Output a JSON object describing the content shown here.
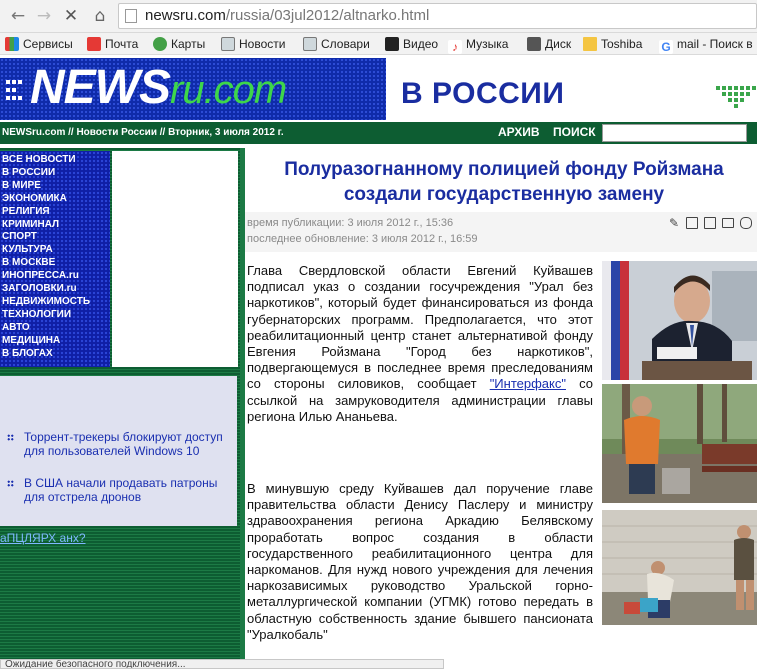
{
  "browser": {
    "url_domain": "newsru.com",
    "url_path": "/russia/03jul2012/altnarko.html",
    "bookmarks": [
      "Сервисы",
      "Почта",
      "Карты",
      "Новости",
      "Словари",
      "Видео",
      "Музыка",
      "Диск",
      "Toshiba",
      "mail - Поиск в"
    ]
  },
  "header": {
    "logo_main": "NEWS",
    "logo_ru": "ru.com",
    "section": "В РОССИИ",
    "breadcrumb": "NEWSru.com // Новости России // Вторник, 3 июля 2012 г.",
    "archive": "АРХИВ",
    "search": "ПОИСК"
  },
  "menu": [
    "ВСЕ НОВОСТИ",
    "В РОССИИ",
    "В МИРЕ",
    "ЭКОНОМИКА",
    "РЕЛИГИЯ",
    "КРИМИНАЛ",
    "СПОРТ",
    "КУЛЬТУРА",
    "В МОСКВЕ",
    "ИНОПРЕССА.ru",
    "ЗАГОЛОВКИ.ru",
    "НЕДВИЖИМОСТЬ",
    "ТЕХНОЛОГИИ",
    "АВТО",
    "МЕДИЦИНА",
    "В БЛОГАХ"
  ],
  "side_news": [
    "Торрент-трекеры блокируют доступ для пользователей Windows 10",
    "В США начали продавать патроны для отстрела дронов"
  ],
  "promo": "аПЦЛЯРХ анх?",
  "article": {
    "headline": "Полуразогнанному полицией фонду Ройзмана создали государственную замену",
    "published": "время публикации: 3 июля 2012 г., 15:36",
    "updated": "последнее обновление: 3 июля 2012 г., 16:59",
    "p1_before": "Глава Свердловской области Евгений Куйвашев подписал указ о создании госучреждения \"Урал без наркотиков\", который будет финансироваться из фонда губернаторских программ. Предполагается, что этот реабилитационный центр станет альтернативой фонду Евгения Ройзмана \"Город без наркотиков\", подвергающемуся в последнее время преследованиям со стороны силовиков, сообщает ",
    "p1_link": "\"Интерфакс\"",
    "p1_after": " со ссылкой на замруководителя администрации главы региона Илью Ананьева.",
    "p2": "В минувшую среду Куйвашев дал поручение главе правительства области Денису Паслеру и министру здравоохранения региона Аркадию Белявскому проработать вопрос создания в области государственного реабилитационного центра для наркоманов. Для нужд нового учреждения для лечения наркозависимых руководство Уральской горно-металлургической компании (УГМК) готово передать в областную собственность здание бывшего пансионата \"Уралкобаль\""
  },
  "status": "Ожидание безопасного подключения..."
}
